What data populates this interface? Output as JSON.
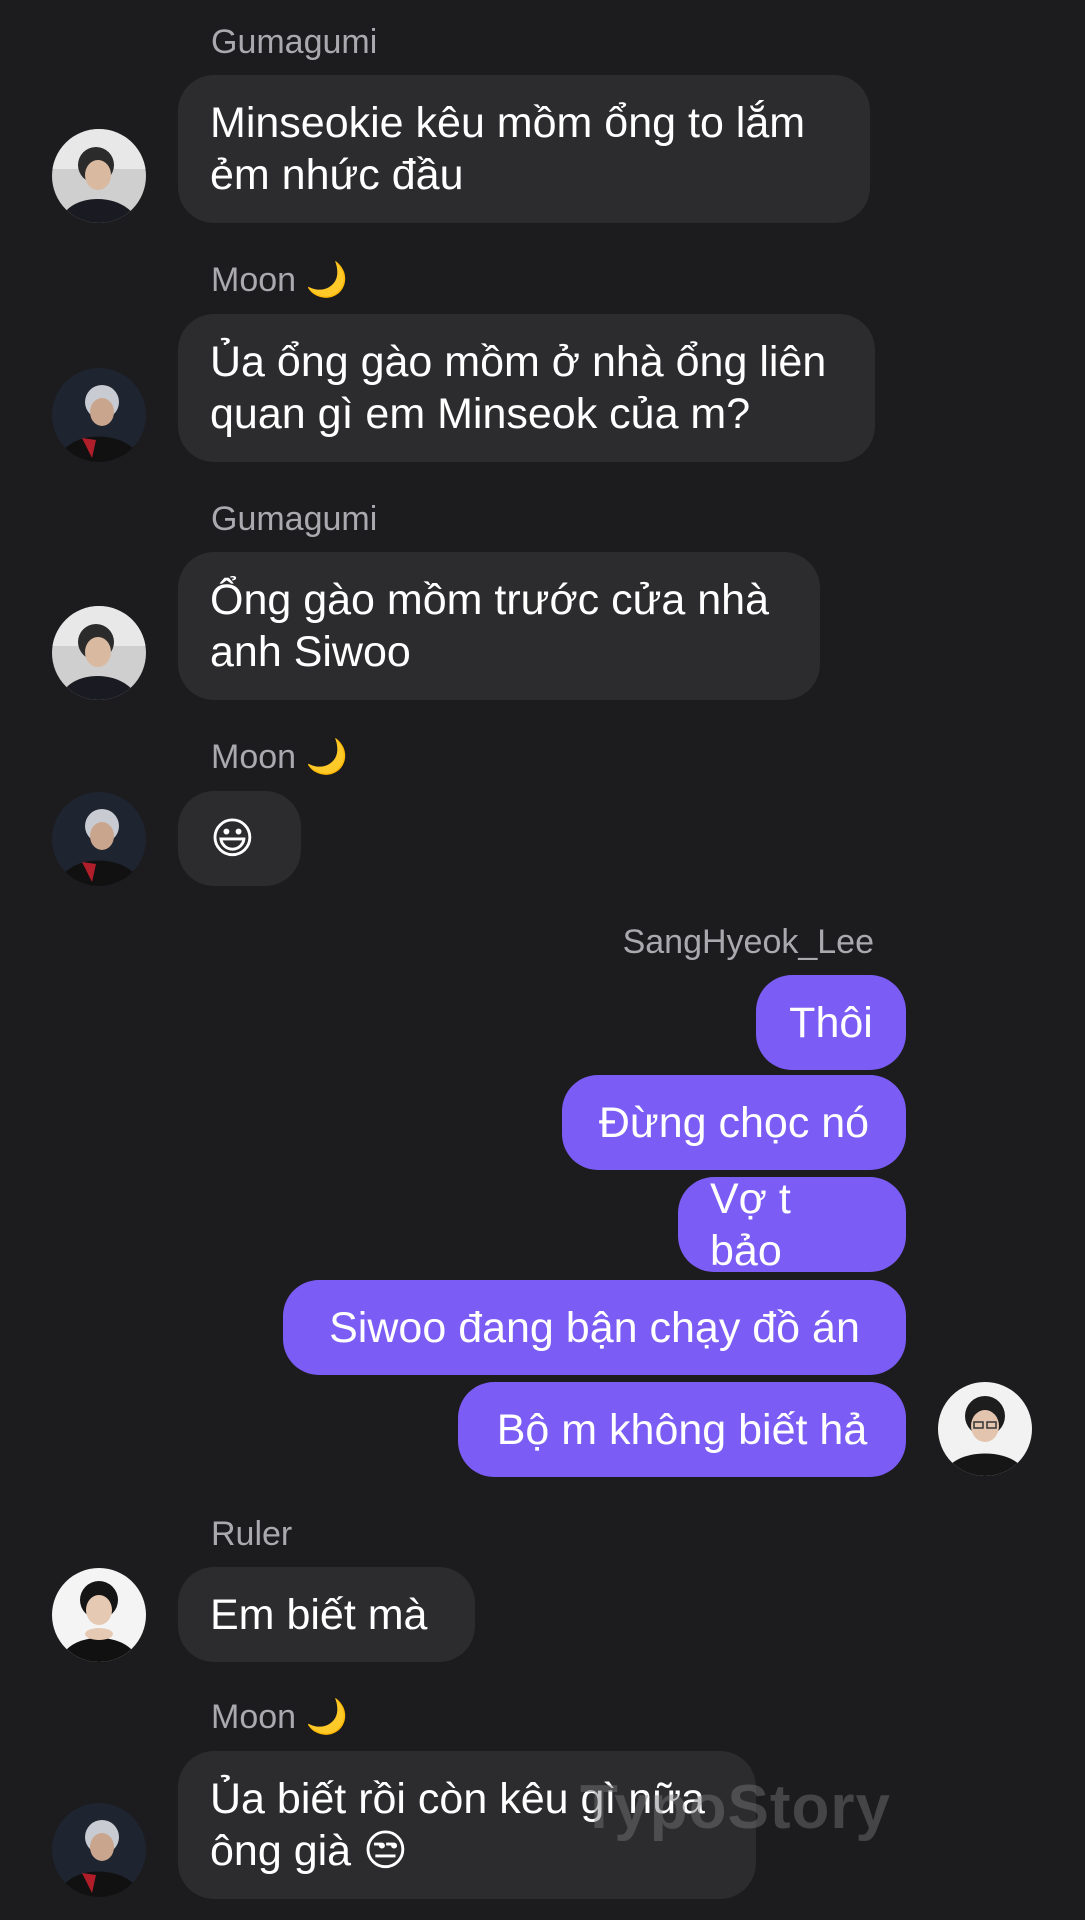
{
  "messages": [
    {
      "sender": "Gumagumi",
      "text": "Minseokie kêu mồm ổng to lắm\nẻm nhức đầu",
      "avatar_icon": "gumagumi-avatar"
    },
    {
      "sender": "Moon 🌙",
      "text": "Ủa ổng gào mồm ở nhà ổng liên\nquan gì em Minseok của m?",
      "avatar_icon": "moon-avatar"
    },
    {
      "sender": "Gumagumi",
      "text": "Ổng gào mồm trước cửa nhà\nanh Siwoo",
      "avatar_icon": "gumagumi-avatar"
    },
    {
      "sender": "Moon 🌙",
      "text": "😃",
      "avatar_icon": "moon-avatar"
    },
    {
      "sender": "SangHyeok_Lee",
      "texts": [
        "Thôi",
        "Đừng chọc nó",
        "Vợ t bảo",
        "Siwoo đang bận chạy đồ án",
        "Bộ m không biết hả"
      ],
      "avatar_icon": "sanghyeok-avatar"
    },
    {
      "sender": "Ruler",
      "text": "Em biết mà",
      "avatar_icon": "ruler-avatar"
    },
    {
      "sender": "Moon 🌙",
      "text": "Ủa biết rồi còn kêu gì nữa\nông già 😒",
      "avatar_icon": "moon-avatar"
    }
  ],
  "watermark": "TypoStory",
  "colors": {
    "background": "#1c1c1e",
    "incoming_bubble": "#2c2c2e",
    "outgoing_bubble": "#7b5cf5",
    "sender_name": "#a9a9ae"
  }
}
